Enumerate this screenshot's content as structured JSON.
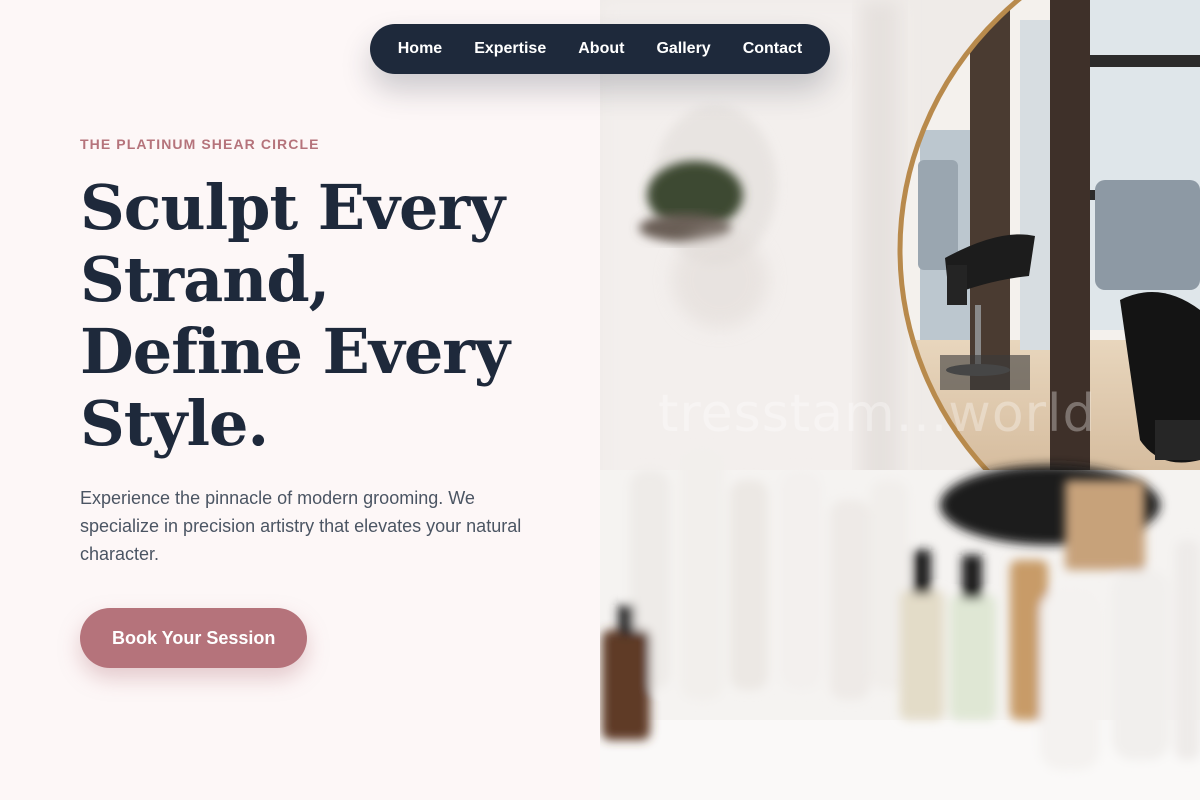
{
  "nav": {
    "items": [
      {
        "label": "Home"
      },
      {
        "label": "Expertise"
      },
      {
        "label": "About"
      },
      {
        "label": "Gallery"
      },
      {
        "label": "Contact"
      }
    ]
  },
  "hero": {
    "eyebrow": "THE PLATINUM SHEAR CIRCLE",
    "headline_lines": [
      "Sculpt Every",
      "Strand,",
      "Define Every",
      "Style."
    ],
    "description": "Experience the pinnacle of modern grooming. We specialize in precision artistry that elevates your natural character.",
    "cta_label": "Book Your Session"
  },
  "image": {
    "subject": "salon-interior-photo",
    "watermark": "tresstam...world"
  },
  "colors": {
    "navy": "#1e293b",
    "rose": "#b5737b",
    "background": "#fdf7f7",
    "body_text": "#4b5563"
  }
}
